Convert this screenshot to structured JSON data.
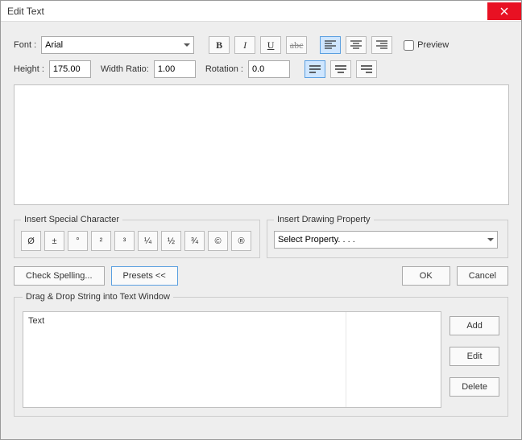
{
  "title": "Edit Text",
  "font": {
    "label": "Font :",
    "value": "Arial"
  },
  "style": {
    "bold": "B",
    "italic": "I",
    "underline": "U",
    "strike": "abc"
  },
  "preview": {
    "label": "Preview"
  },
  "height": {
    "label": "Height :",
    "value": "175.00"
  },
  "width_ratio": {
    "label": "Width Ratio:",
    "value": "1.00"
  },
  "rotation": {
    "label": "Rotation :",
    "value": "0.0"
  },
  "special": {
    "legend": "Insert Special Character",
    "chars": [
      "Ø",
      "±",
      "°",
      "²",
      "³",
      "¼",
      "½",
      "¾",
      "©",
      "®"
    ]
  },
  "drawing_prop": {
    "legend": "Insert Drawing Property",
    "selected": "Select Property. . . ."
  },
  "buttons": {
    "check_spelling": "Check Spelling...",
    "presets": "Presets  <<",
    "ok": "OK",
    "cancel": "Cancel",
    "add": "Add",
    "edit": "Edit",
    "delete": "Delete"
  },
  "drag": {
    "legend": "Drag & Drop String into Text Window",
    "items": [
      "Text"
    ]
  }
}
